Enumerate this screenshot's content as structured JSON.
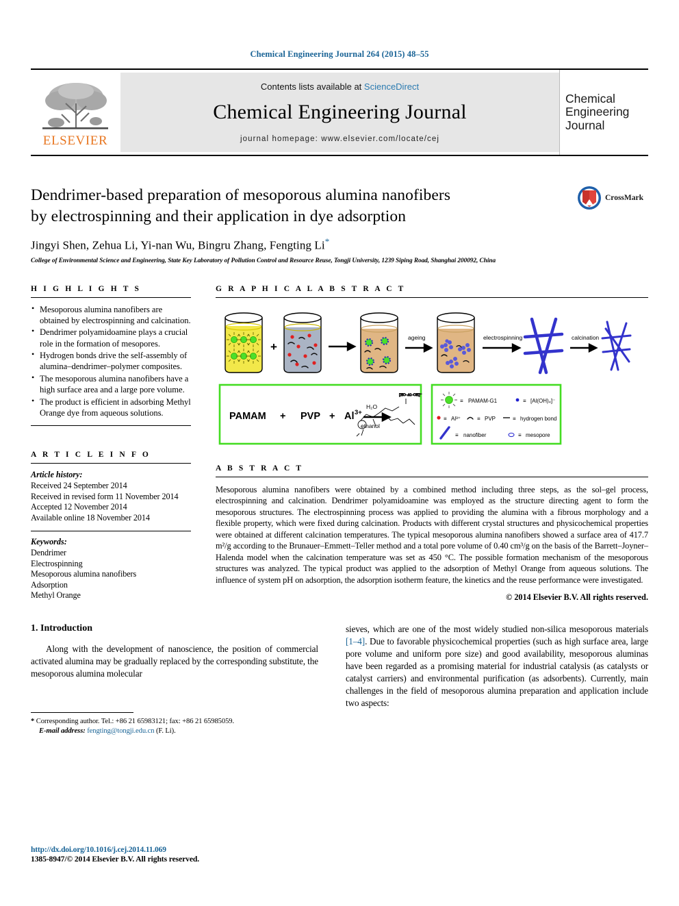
{
  "running_head": "Chemical Engineering Journal 264 (2015) 48–55",
  "masthead": {
    "publisher": "ELSEVIER",
    "contents_prefix": "Contents lists available at",
    "contents_link": "ScienceDirect",
    "journal_title": "Chemical Engineering Journal",
    "homepage": "journal homepage: www.elsevier.com/locate/cej",
    "cover_line1": "Chemical",
    "cover_line2": "Engineering",
    "cover_line3": "Journal"
  },
  "article": {
    "title_line1": "Dendrimer-based preparation of mesoporous alumina nanofibers",
    "title_line2": "by electrospinning and their application in dye adsorption",
    "authors": "Jingyi Shen, Zehua Li, Yi-nan Wu, Bingru Zhang, Fengting Li",
    "corresponding_marker": "*",
    "affiliation": "College of Environmental Science and Engineering, State Key Laboratory of Pollution Control and Resource Reuse, Tongji University, 1239 Siping Road, Shanghai 200092, China",
    "crossmark_label": "CrossMark"
  },
  "highlights": {
    "heading": "H I G H L I G H T S",
    "items": [
      "Mesoporous alumina nanofibers are obtained by electrospinning and calcination.",
      "Dendrimer polyamidoamine plays a crucial role in the formation of mesopores.",
      "Hydrogen bonds drive the self-assembly of alumina–dendrimer–polymer composites.",
      "The mesoporous alumina nanofibers have a high surface area and a large pore volume.",
      "The product is efficient in adsorbing Methyl Orange dye from aqueous solutions."
    ]
  },
  "article_info": {
    "heading": "A R T I C L E    I N F O",
    "history_label": "Article history:",
    "history": [
      "Received 24 September 2014",
      "Received in revised form 11 November 2014",
      "Accepted 12 November 2014",
      "Available online 18 November 2014"
    ],
    "keywords_label": "Keywords:",
    "keywords": [
      "Dendrimer",
      "Electrospinning",
      "Mesoporous alumina nanofibers",
      "Adsorption",
      "Methyl Orange"
    ]
  },
  "graphical_abstract": {
    "heading": "G R A P H I C A L   A B S T R A C T",
    "plus_sign": "+",
    "step_labels": [
      "ageing",
      "electrospinning",
      "calcination"
    ],
    "reaction": {
      "reactant1": "PAMAM",
      "plus1": "+",
      "reactant2": "PVP",
      "plus2": "+",
      "reactant3": "Al",
      "reactant3_sup": "3+",
      "solvent_top": "H2O",
      "solvent_bottom": "ethanol",
      "product_label": "[HO–Al–OH]⁻"
    },
    "legend": [
      {
        "symbol": "green-star",
        "equals": "≡",
        "label": "PAMAM-G1"
      },
      {
        "symbol": "blue-dot",
        "equals": "≡",
        "label": "[Al(OH)4]⁻"
      },
      {
        "symbol": "red-dot",
        "equals": "≡",
        "label": "Al³⁺"
      },
      {
        "symbol": "squiggle",
        "equals": "≡",
        "label": "PVP"
      },
      {
        "symbol": "dash",
        "equals": "≡",
        "label": "hydrogen bond"
      },
      {
        "symbol": "blue-line",
        "equals": "≡",
        "label": "nanofiber"
      },
      {
        "symbol": "open-circle",
        "equals": "≡",
        "label": "mesopore"
      }
    ]
  },
  "abstract": {
    "heading": "A B S T R A C T",
    "text": "Mesoporous alumina nanofibers were obtained by a combined method including three steps, as the sol–gel process, electrospinning and calcination. Dendrimer polyamidoamine was employed as the structure directing agent to form the mesoporous structures. The electrospinning process was applied to providing the alumina with a fibrous morphology and a flexible property, which were fixed during calcination. Products with different crystal structures and physicochemical properties were obtained at different calcination temperatures. The typical mesoporous alumina nanofibers showed a surface area of 417.7 m²/g according to the Brunauer–Emmett–Teller method and a total pore volume of 0.40 cm³/g on the basis of the Barrett–Joyner–Halenda model when the calcination temperature was set as 450 °C. The possible formation mechanism of the mesoporous structures was analyzed. The typical product was applied to the adsorption of Methyl Orange from aqueous solutions. The influence of system pH on adsorption, the adsorption isotherm feature, the kinetics and the reuse performance were investigated.",
    "copyright": "© 2014 Elsevier B.V. All rights reserved."
  },
  "introduction": {
    "heading": "1. Introduction",
    "left_paragraph": "Along with the development of nanoscience, the position of commercial activated alumina may be gradually replaced by the corresponding substitute, the mesoporous alumina molecular",
    "right_part1": "sieves, which are one of the most widely studied non-silica mesoporous materials ",
    "right_citation": "[1–4]",
    "right_part2": ". Due to favorable physicochemical properties (such as high surface area, large pore volume and uniform pore size) and good availability, mesoporous aluminas have been regarded as a promising material for industrial catalysis (as catalysts or catalyst carriers) and environmental purification (as adsorbents). Currently, main challenges in the field of mesoporous alumina preparation and application include two aspects:"
  },
  "footnote": {
    "marker": "*",
    "corresponding": "Corresponding author. Tel.: +86 21 65983121; fax: +86 21 65985059.",
    "email_label": "E-mail address:",
    "email": "fengting@tongji.edu.cn",
    "email_suffix": "(F. Li)."
  },
  "doc_footer": {
    "doi": "http://dx.doi.org/10.1016/j.cej.2014.11.069",
    "issn": "1385-8947/© 2014 Elsevier B.V. All rights reserved."
  },
  "colors": {
    "link_blue": "#1a6496",
    "elsevier_orange": "#E87722",
    "masthead_gray": "#e6e6e6",
    "beaker_yellow": "#f2e84a",
    "beaker_gray_blue": "#aab4c4",
    "beaker_tan": "#e0b684",
    "pamam_green": "#4ce02a",
    "al_red": "#e02020",
    "fiber_blue": "#3333cc",
    "legend_border_green": "#44dd22"
  }
}
